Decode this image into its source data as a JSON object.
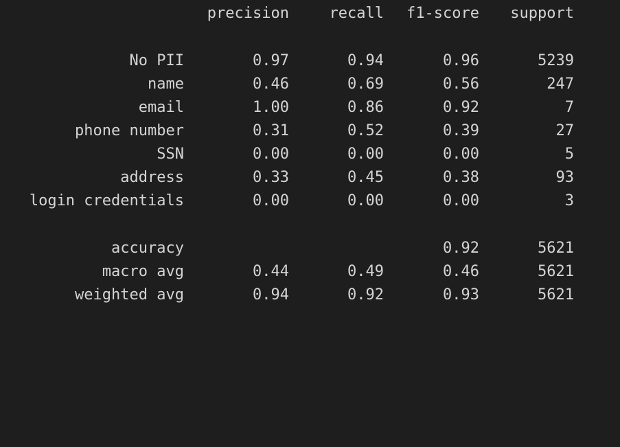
{
  "headers": {
    "precision": "precision",
    "recall": "recall",
    "f1_score": "f1-score",
    "support": "support"
  },
  "classes": [
    {
      "label": "No PII",
      "precision": "0.97",
      "recall": "0.94",
      "f1": "0.96",
      "support": "5239"
    },
    {
      "label": "name",
      "precision": "0.46",
      "recall": "0.69",
      "f1": "0.56",
      "support": "247"
    },
    {
      "label": "email",
      "precision": "1.00",
      "recall": "0.86",
      "f1": "0.92",
      "support": "7"
    },
    {
      "label": "phone number",
      "precision": "0.31",
      "recall": "0.52",
      "f1": "0.39",
      "support": "27"
    },
    {
      "label": "SSN",
      "precision": "0.00",
      "recall": "0.00",
      "f1": "0.00",
      "support": "5"
    },
    {
      "label": "address",
      "precision": "0.33",
      "recall": "0.45",
      "f1": "0.38",
      "support": "93"
    },
    {
      "label": "login credentials",
      "precision": "0.00",
      "recall": "0.00",
      "f1": "0.00",
      "support": "3"
    }
  ],
  "summary": [
    {
      "label": "accuracy",
      "precision": "",
      "recall": "",
      "f1": "0.92",
      "support": "5621"
    },
    {
      "label": "macro avg",
      "precision": "0.44",
      "recall": "0.49",
      "f1": "0.46",
      "support": "5621"
    },
    {
      "label": "weighted avg",
      "precision": "0.94",
      "recall": "0.92",
      "f1": "0.93",
      "support": "5621"
    }
  ]
}
